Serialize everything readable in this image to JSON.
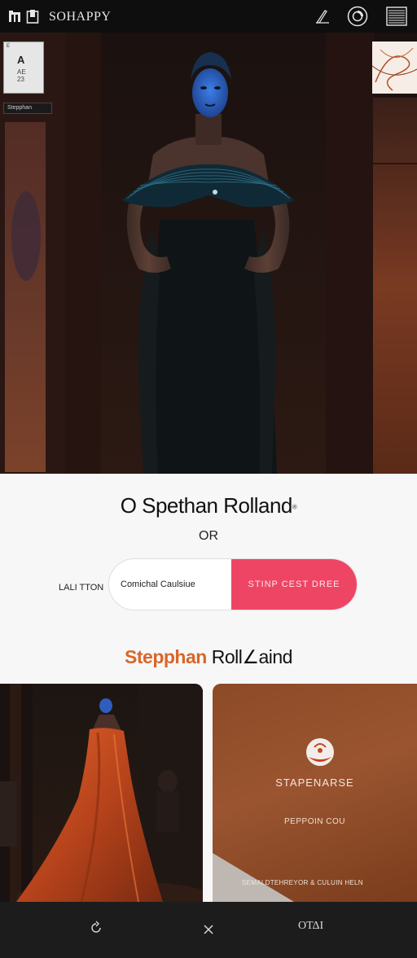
{
  "topbar": {
    "brand": "SOHAPPY",
    "icons": [
      "logo-mark-icon",
      "bookmark-icon",
      "pen-icon",
      "circle-target-icon",
      "menu-lines-icon"
    ]
  },
  "hero": {
    "mini_card": {
      "corner": "E",
      "big": "A",
      "line1": "AE",
      "line2": "23"
    },
    "mini_label": "Stepphan",
    "colors": {
      "background": "#1d1210",
      "curtain": "#2a1815",
      "accent_blue": "#2f6dd6"
    }
  },
  "info": {
    "designer_name": "O Spethan Rolland",
    "registered_mark": "®",
    "or_text": "OR",
    "side_label": "LALI TTON",
    "pill_left": "Comichal Caulsiue",
    "pill_right": "STINP CEST DREE",
    "brand_first": "Stepphan",
    "brand_last": "Roll∠aind",
    "colors": {
      "pill_accent": "#ef4565",
      "brand_orange": "#d9662a"
    }
  },
  "cards": {
    "right_title": "STAPENARSE",
    "right_sub": "PEPPOIN COU",
    "right_footer": "SEMALDTEHREYOR & CULUIN HELN"
  },
  "bottomnav": {
    "right_text": "ОΤΔI",
    "icons": [
      "refresh-icon",
      "close-icon"
    ]
  }
}
